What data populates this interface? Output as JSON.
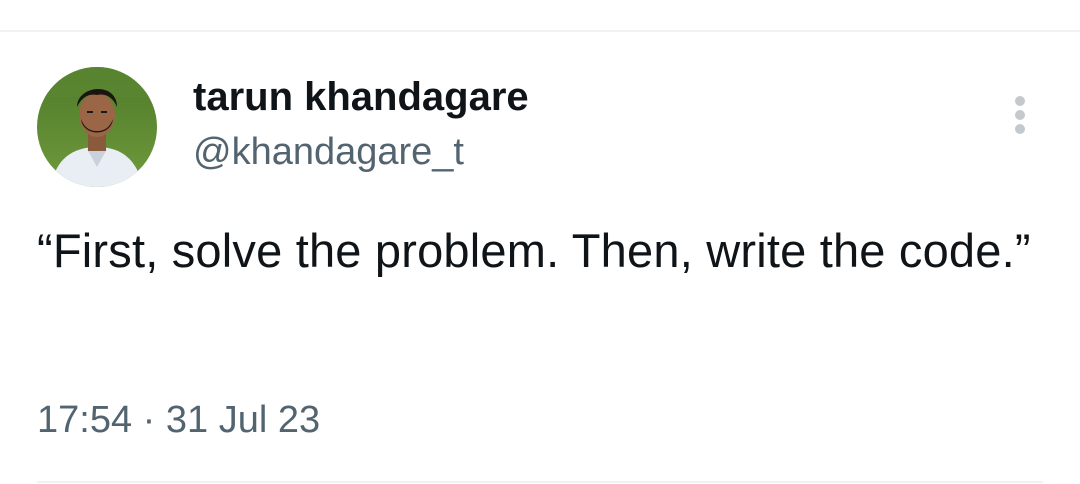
{
  "tweet": {
    "author": {
      "display_name": "tarun khandagare",
      "handle": "@khandagare_t"
    },
    "text": "“First, solve the problem. Then, write the code.”",
    "time": "17:54",
    "separator": "·",
    "date": "31 Jul 23"
  },
  "icons": {
    "more": "more-vertical-icon",
    "avatar": "profile-photo"
  },
  "colors": {
    "primary_text": "#0f1419",
    "secondary_text": "#536471",
    "icon_gray": "#c4c9ce",
    "divider": "#eff3f4",
    "background": "#ffffff"
  }
}
